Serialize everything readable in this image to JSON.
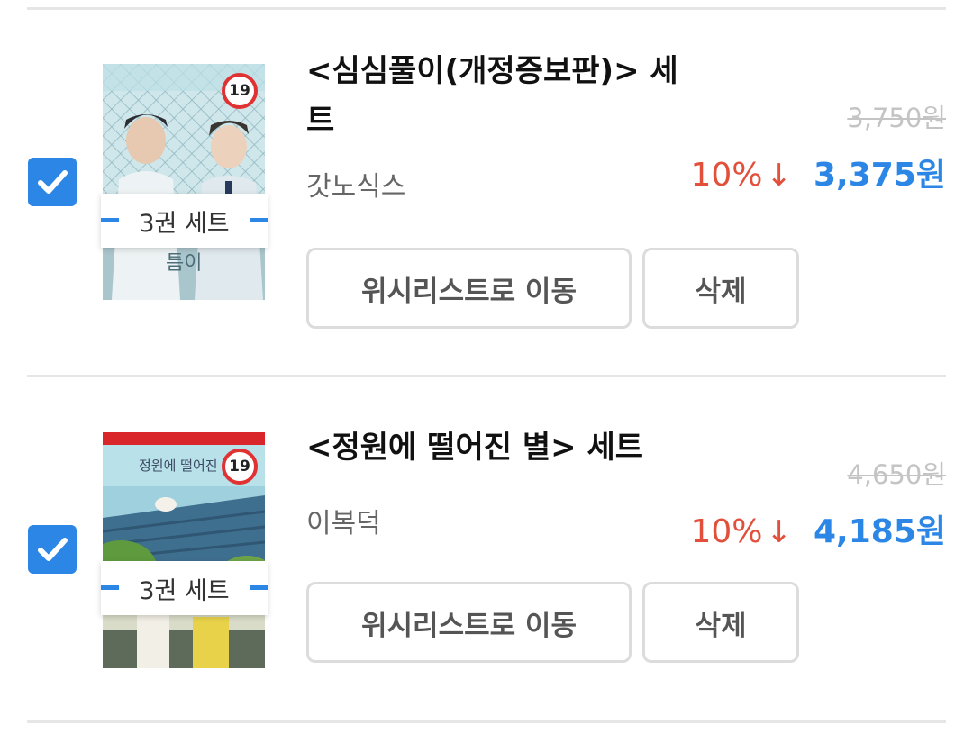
{
  "items": [
    {
      "checked": true,
      "age_rating": "19",
      "set_label": "3권 세트",
      "title_line1": "<심심풀이(개정증보판)> 세",
      "title_line2": "트",
      "author": "갓노식스",
      "original_price": "3,750원",
      "discount": "10%",
      "final_price": "3,375원",
      "wishlist_label": "위시리스트로 이동",
      "delete_label": "삭제"
    },
    {
      "checked": true,
      "age_rating": "19",
      "cover_title": "정원에 떨어진 별",
      "set_label": "3권 세트",
      "title_line1": "<정원에 떨어진 별> 세트",
      "title_line2": "",
      "author": "이복덕",
      "original_price": "4,650원",
      "discount": "10%",
      "final_price": "4,185원",
      "wishlist_label": "위시리스트로 이동",
      "delete_label": "삭제"
    }
  ],
  "icons": {
    "check": "checkmark-icon",
    "discount_arrow": "arrow-down-icon"
  },
  "colors": {
    "accent": "#2b86e6",
    "discount": "#e2503b",
    "strike": "#c4c4c4"
  }
}
